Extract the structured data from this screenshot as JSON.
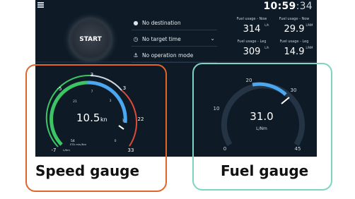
{
  "topbar": {
    "clock_hm": "10:59",
    "clock_sec": ":34"
  },
  "start_button": {
    "label": "START"
  },
  "options": [
    {
      "icon": "location-pin-icon",
      "label": "No destination",
      "has_dropdown": false
    },
    {
      "icon": "clock-icon",
      "label": "No target time",
      "has_dropdown": true
    },
    {
      "icon": "ship-icon",
      "label": "No operation mode",
      "has_dropdown": false
    }
  ],
  "fuel_stats": {
    "now_lh": {
      "label": "Fuel usage - Now",
      "value": "314",
      "unit": "L/h"
    },
    "now_lnm": {
      "label": "Fuel usage - Now",
      "value": "29.9",
      "unit": "L/NM"
    },
    "leg_lh": {
      "label": "Fuel usage - Leg",
      "value": "309",
      "unit": "L/h"
    },
    "leg_lnm": {
      "label": "Fuel usage - Leg",
      "value": "14.9",
      "unit": "L/NM"
    }
  },
  "speed_gauge": {
    "value": "10.5",
    "unit": "kn",
    "ticks": [
      "-7",
      "-5",
      "3",
      "3",
      "22",
      "33"
    ],
    "inner_marks": [
      "21",
      "7",
      "3",
      "1",
      "0"
    ],
    "eta_value": "54",
    "eta_label": "ETA min/Nm",
    "eta_unit": "L/Nm"
  },
  "fuel_gauge": {
    "value": "31.0",
    "unit": "L/Nm",
    "ticks": [
      "0",
      "10",
      "20",
      "30",
      "45"
    ]
  },
  "captions": {
    "speed": "Speed gauge",
    "fuel": "Fuel gauge"
  },
  "colors": {
    "panel_bg": "#0e1b26",
    "speed_frame": "#e2662a",
    "fuel_frame": "#7dd4c3",
    "gauge_blue": "#4aa8f2",
    "gauge_green": "#3cc564",
    "gauge_red": "#e04a3a"
  }
}
